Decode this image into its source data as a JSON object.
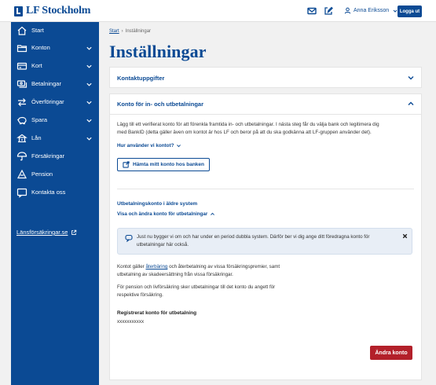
{
  "header": {
    "logo_text": "LF Stockholm",
    "user_name": "Anna Eriksson",
    "logout_label": "Logga ut",
    "icons": [
      "mail-icon",
      "edit-icon",
      "user-icon",
      "chevron-down-icon"
    ]
  },
  "sidebar": {
    "items": [
      {
        "label": "Start",
        "icon": "home-icon",
        "expandable": false
      },
      {
        "label": "Konton",
        "icon": "folder-icon",
        "expandable": true
      },
      {
        "label": "Kort",
        "icon": "card-icon",
        "expandable": true
      },
      {
        "label": "Betalningar",
        "icon": "payments-icon",
        "expandable": true
      },
      {
        "label": "Överföringar",
        "icon": "transfer-icon",
        "expandable": true
      },
      {
        "label": "Spara",
        "icon": "piggybank-icon",
        "expandable": true
      },
      {
        "label": "Lån",
        "icon": "loan-icon",
        "expandable": true
      },
      {
        "label": "Försäkringar",
        "icon": "umbrella-icon",
        "expandable": false
      },
      {
        "label": "Pension",
        "icon": "pension-icon",
        "expandable": false
      },
      {
        "label": "Kontakta oss",
        "icon": "chat-icon",
        "expandable": false
      }
    ],
    "external_link": "Länsförsäkringar.se"
  },
  "breadcrumb": {
    "root": "Start",
    "separator": "›",
    "current": "Inställningar"
  },
  "page": {
    "title": "Inställningar"
  },
  "contact_card": {
    "title": "Kontaktuppgifter"
  },
  "account_card": {
    "title": "Konto för in- och utbetalningar",
    "intro_line1": "Lägg till ett verifierat konto för att förenkla framtida in- och utbetalningar. I nästa steg får du välja bank och legitimera dig",
    "intro_line2": "med BankID (detta gäller även om kontot är hos LF och beror på att du ska godkänna att LF-gruppen använder det).",
    "how_link": "Hur använder vi kontot?",
    "fetch_button": "Hämta mitt konto hos banken",
    "legacy_title": "Utbetalningskonto i äldre system",
    "legacy_link": "Visa och ändra konto för utbetalningar",
    "info_line1": "Just nu bygger vi om och har under en period dubbla system. Därför ber vi dig ange ditt föredragna konto för",
    "info_line2": "utbetalningar här också.",
    "para1_before": "Kontot gäller ",
    "para1_link": "återbäring",
    "para1_after": " och återbetalning av vissa försäkringspremier, samt",
    "para1_line2": "utbetalning av skadeersättning från vissa försäkringar.",
    "para2_line1": "För pension och livförsäkring sker utbetalningar till det konto du angett för",
    "para2_line2": "respektive försäkring.",
    "registered_label": "Registrerat konto för utbetalning",
    "registered_value": "xxxxxxxxxxx",
    "change_button": "Ändra konto"
  },
  "colors": {
    "brand_blue": "#0b4a94",
    "danger_red": "#b3202a",
    "info_bg": "#e8eef6",
    "page_bg": "#f1f1f1"
  }
}
